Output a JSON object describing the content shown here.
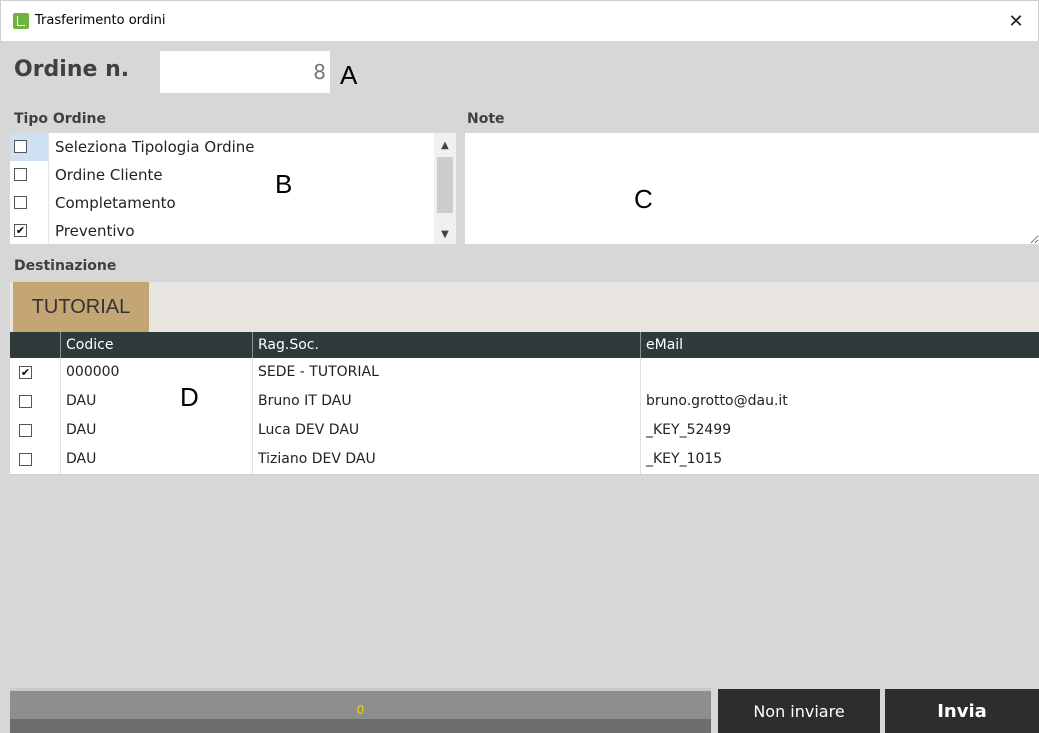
{
  "window": {
    "title": "Trasferimento ordini",
    "close_glyph": "✕"
  },
  "ordine": {
    "label": "Ordine n.",
    "value": "8",
    "marker": "A"
  },
  "tipo_ordine": {
    "label": "Tipo Ordine",
    "marker": "B",
    "items": [
      {
        "label": "Seleziona Tipologia Ordine",
        "checked": false
      },
      {
        "label": "Ordine Cliente",
        "checked": false
      },
      {
        "label": "Completamento",
        "checked": false
      },
      {
        "label": "Preventivo",
        "checked": true
      }
    ]
  },
  "note": {
    "label": "Note",
    "marker": "C",
    "value": ""
  },
  "destinazione": {
    "label": "Destinazione",
    "tab": "TUTORIAL",
    "marker": "D",
    "columns": [
      "Codice",
      "Rag.Soc.",
      "eMail"
    ],
    "rows": [
      {
        "checked": true,
        "codice": "000000",
        "ragsoc": "SEDE - TUTORIAL",
        "email": ""
      },
      {
        "checked": false,
        "codice": "DAU",
        "ragsoc": "Bruno IT DAU",
        "email": "bruno.grotto@dau.it"
      },
      {
        "checked": false,
        "codice": "DAU",
        "ragsoc": "Luca DEV DAU",
        "email": "_KEY_52499"
      },
      {
        "checked": false,
        "codice": "DAU",
        "ragsoc": "Tiziano DEV DAU",
        "email": "_KEY_1015"
      }
    ]
  },
  "progress": {
    "text": "0",
    "value": 0
  },
  "buttons": {
    "non_inviare": "Non inviare",
    "invia": "Invia"
  },
  "icons": {
    "app": "app-document-icon",
    "close": "close-icon",
    "scroll_up": "chevron-up-icon",
    "scroll_down": "chevron-down-icon",
    "check": "checkmark-icon"
  },
  "colors": {
    "tab_active": "#c4a574",
    "grid_header": "#2e3a3c",
    "button_dark": "#2d2d2d",
    "progress_text": "#f2d200",
    "background": "#d7d7d7"
  }
}
